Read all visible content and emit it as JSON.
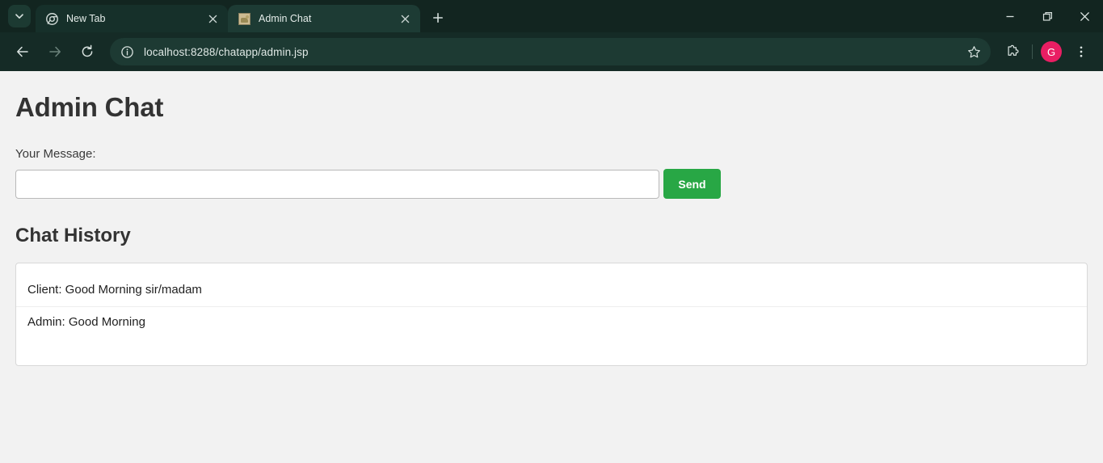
{
  "browser": {
    "tablist_icon": "chevron-down-icon",
    "tabs": [
      {
        "title": "New Tab",
        "favicon": "chrome-logo-icon",
        "active": false,
        "close_icon": "close-icon"
      },
      {
        "title": "Admin Chat",
        "favicon": "broken-image-favicon",
        "active": true,
        "close_icon": "close-icon"
      }
    ],
    "new_tab_icon": "plus-icon",
    "window_controls": {
      "minimize": "minimize-icon",
      "maximize": "restore-icon",
      "close": "close-icon"
    },
    "toolbar": {
      "back_icon": "arrow-left-icon",
      "forward_icon": "arrow-right-icon",
      "reload_icon": "reload-icon",
      "site_info_icon": "info-circle-icon",
      "url": "localhost:8288/chatapp/admin.jsp",
      "url_placeholder": "Search Google or type a URL",
      "bookmark_icon": "star-icon",
      "extensions_icon": "puzzle-piece-icon",
      "profile_initial": "G",
      "menu_icon": "three-dot-menu-icon"
    },
    "theme": {
      "tabstrip_bg": "#122520",
      "toolbar_bg": "#152b26",
      "active_tab_bg": "#1d3b34",
      "omnibox_bg": "#1d3a33",
      "avatar_bg": "#e91e63"
    }
  },
  "page": {
    "title": "Admin Chat",
    "message_label": "Your Message:",
    "message_value": "",
    "message_placeholder": "",
    "send_label": "Send",
    "send_color": "#28a745",
    "history_title": "Chat History",
    "messages": [
      {
        "text": "Client: Good Morning sir/madam"
      },
      {
        "text": "Admin: Good Morning"
      }
    ]
  }
}
